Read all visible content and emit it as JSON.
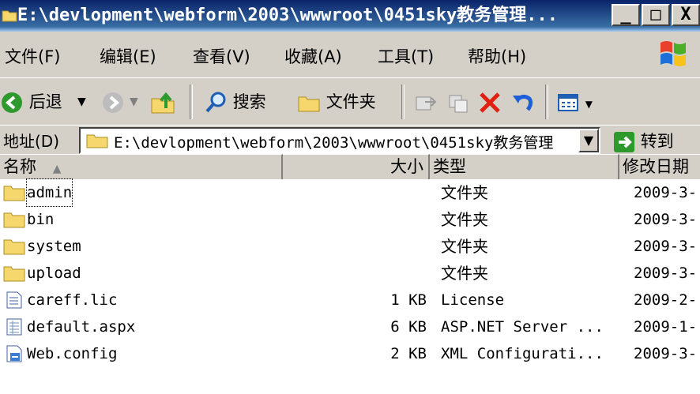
{
  "window": {
    "title": "E:\\devlopment\\webform\\2003\\wwwroot\\0451sky教务管理...",
    "minimize": "_",
    "maximize": "□",
    "close": "X"
  },
  "menu": [
    "文件(F)",
    "编辑(E)",
    "查看(V)",
    "收藏(A)",
    "工具(T)",
    "帮助(H)"
  ],
  "toolbar": {
    "back": "后退",
    "search": "搜索",
    "folders": "文件夹"
  },
  "address": {
    "label": "地址(D)",
    "value": "E:\\devlopment\\webform\\2003\\wwwroot\\0451sky教务管理",
    "go": "转到"
  },
  "columns": {
    "name": "名称",
    "size": "大小",
    "type": "类型",
    "modified": "修改日期"
  },
  "files": [
    {
      "name": "admin",
      "size": "",
      "type": "文件夹",
      "modified": "2009-3-",
      "icon": "folder-icon"
    },
    {
      "name": "bin",
      "size": "",
      "type": "文件夹",
      "modified": "2009-3-",
      "icon": "folder-icon"
    },
    {
      "name": "system",
      "size": "",
      "type": "文件夹",
      "modified": "2009-3-",
      "icon": "folder-icon"
    },
    {
      "name": "upload",
      "size": "",
      "type": "文件夹",
      "modified": "2009-3-",
      "icon": "folder-icon"
    },
    {
      "name": "careff.lic",
      "size": "1 KB",
      "type": "License",
      "modified": "2009-2-",
      "icon": "text-file-icon"
    },
    {
      "name": "default.aspx",
      "size": "6 KB",
      "type": "ASP.NET Server ...",
      "modified": "2009-1-",
      "icon": "aspx-file-icon"
    },
    {
      "name": "Web.config",
      "size": "2 KB",
      "type": "XML Configurati...",
      "modified": "2009-3-",
      "icon": "config-file-icon"
    }
  ],
  "colors": {
    "titlebar": "#0a246a",
    "chrome": "#d4d0c8",
    "folder": "#f5d76e"
  }
}
